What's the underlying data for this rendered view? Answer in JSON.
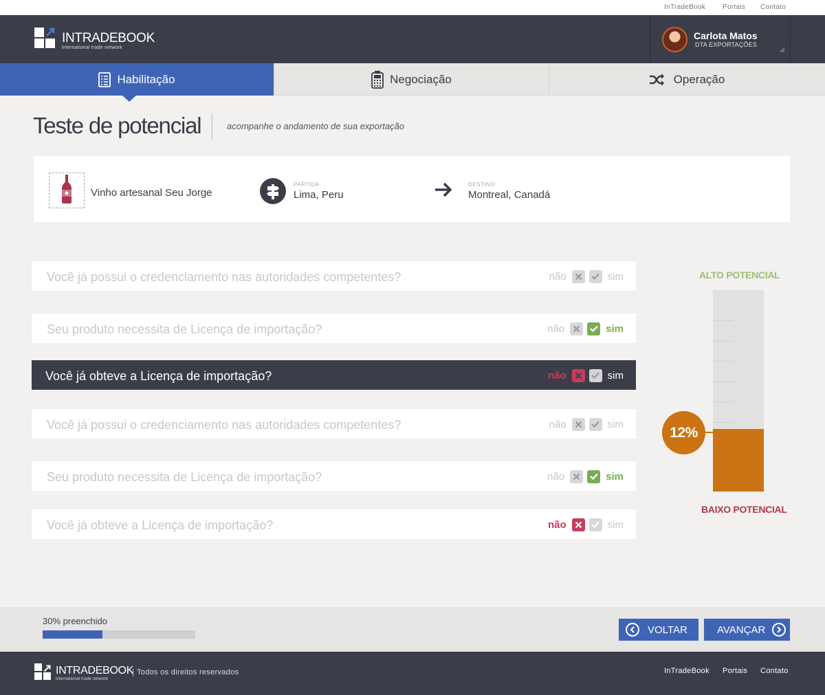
{
  "topnav": {
    "links": [
      "InTradeBook",
      "Portais",
      "Contato"
    ]
  },
  "brand": {
    "name": "INTRADEBOOK",
    "tagline": "international trade network"
  },
  "user": {
    "name": "Carlota Matos",
    "role": "DTA EXPORTAÇÕES"
  },
  "tabs": [
    {
      "label": "Habilitação",
      "icon": "checklist-icon",
      "active": true
    },
    {
      "label": "Negociação",
      "icon": "calculator-icon",
      "active": false
    },
    {
      "label": "Operação",
      "icon": "shuffle-icon",
      "active": false
    }
  ],
  "page": {
    "title": "Teste de potencial",
    "subtitle": "acompanhe o andamento de sua exportação"
  },
  "route": {
    "product": {
      "name": "Vinho artesanal Seu Jorge",
      "icon": "wine-bottle-icon"
    },
    "origin": {
      "label": "PARTIDA",
      "value": "Lima, Peru",
      "icon": "signpost-icon"
    },
    "destination": {
      "label": "DESTINO",
      "value": "Montreal, Canadá",
      "icon": "arrow-right-icon"
    }
  },
  "answer_labels": {
    "no": "não",
    "yes": "sim"
  },
  "questions": [
    {
      "text": "Você já possui o credenciamento nas autoridades competentes?",
      "answer": null,
      "active": false
    },
    {
      "text": "Seu produto necessita de Licença de importação?",
      "answer": "sim",
      "active": false
    },
    {
      "text": "Você já obteve a Licença de importação?",
      "answer": "não",
      "active": true
    },
    {
      "text": "Você já possui o credenciamento nas autoridades competentes?",
      "answer": null,
      "active": false
    },
    {
      "text": "Seu produto necessita de Licença de importação?",
      "answer": "sim",
      "active": false
    },
    {
      "text": "Você já obteve a Licença de importação?",
      "answer": "não",
      "active": false
    }
  ],
  "gauge": {
    "top_label": "ALTO POTENCIAL",
    "bottom_label": "BAIXO POTENCIAL",
    "value_label": "12%",
    "fill_fraction": 0.31
  },
  "progress": {
    "label": "30% preenchido",
    "fraction": 0.39
  },
  "actions": {
    "back": "VOLTAR",
    "next": "AVANÇAR"
  },
  "footer": {
    "rights": "Todos os direitos reservados",
    "separator": "|",
    "links": [
      "InTradeBook",
      "Portais",
      "Contato"
    ]
  },
  "colors": {
    "primary": "#3f64b5",
    "dark": "#3b3d49",
    "accent": "#cc7313",
    "no": "#c53c5c",
    "yes": "#79ad54"
  }
}
